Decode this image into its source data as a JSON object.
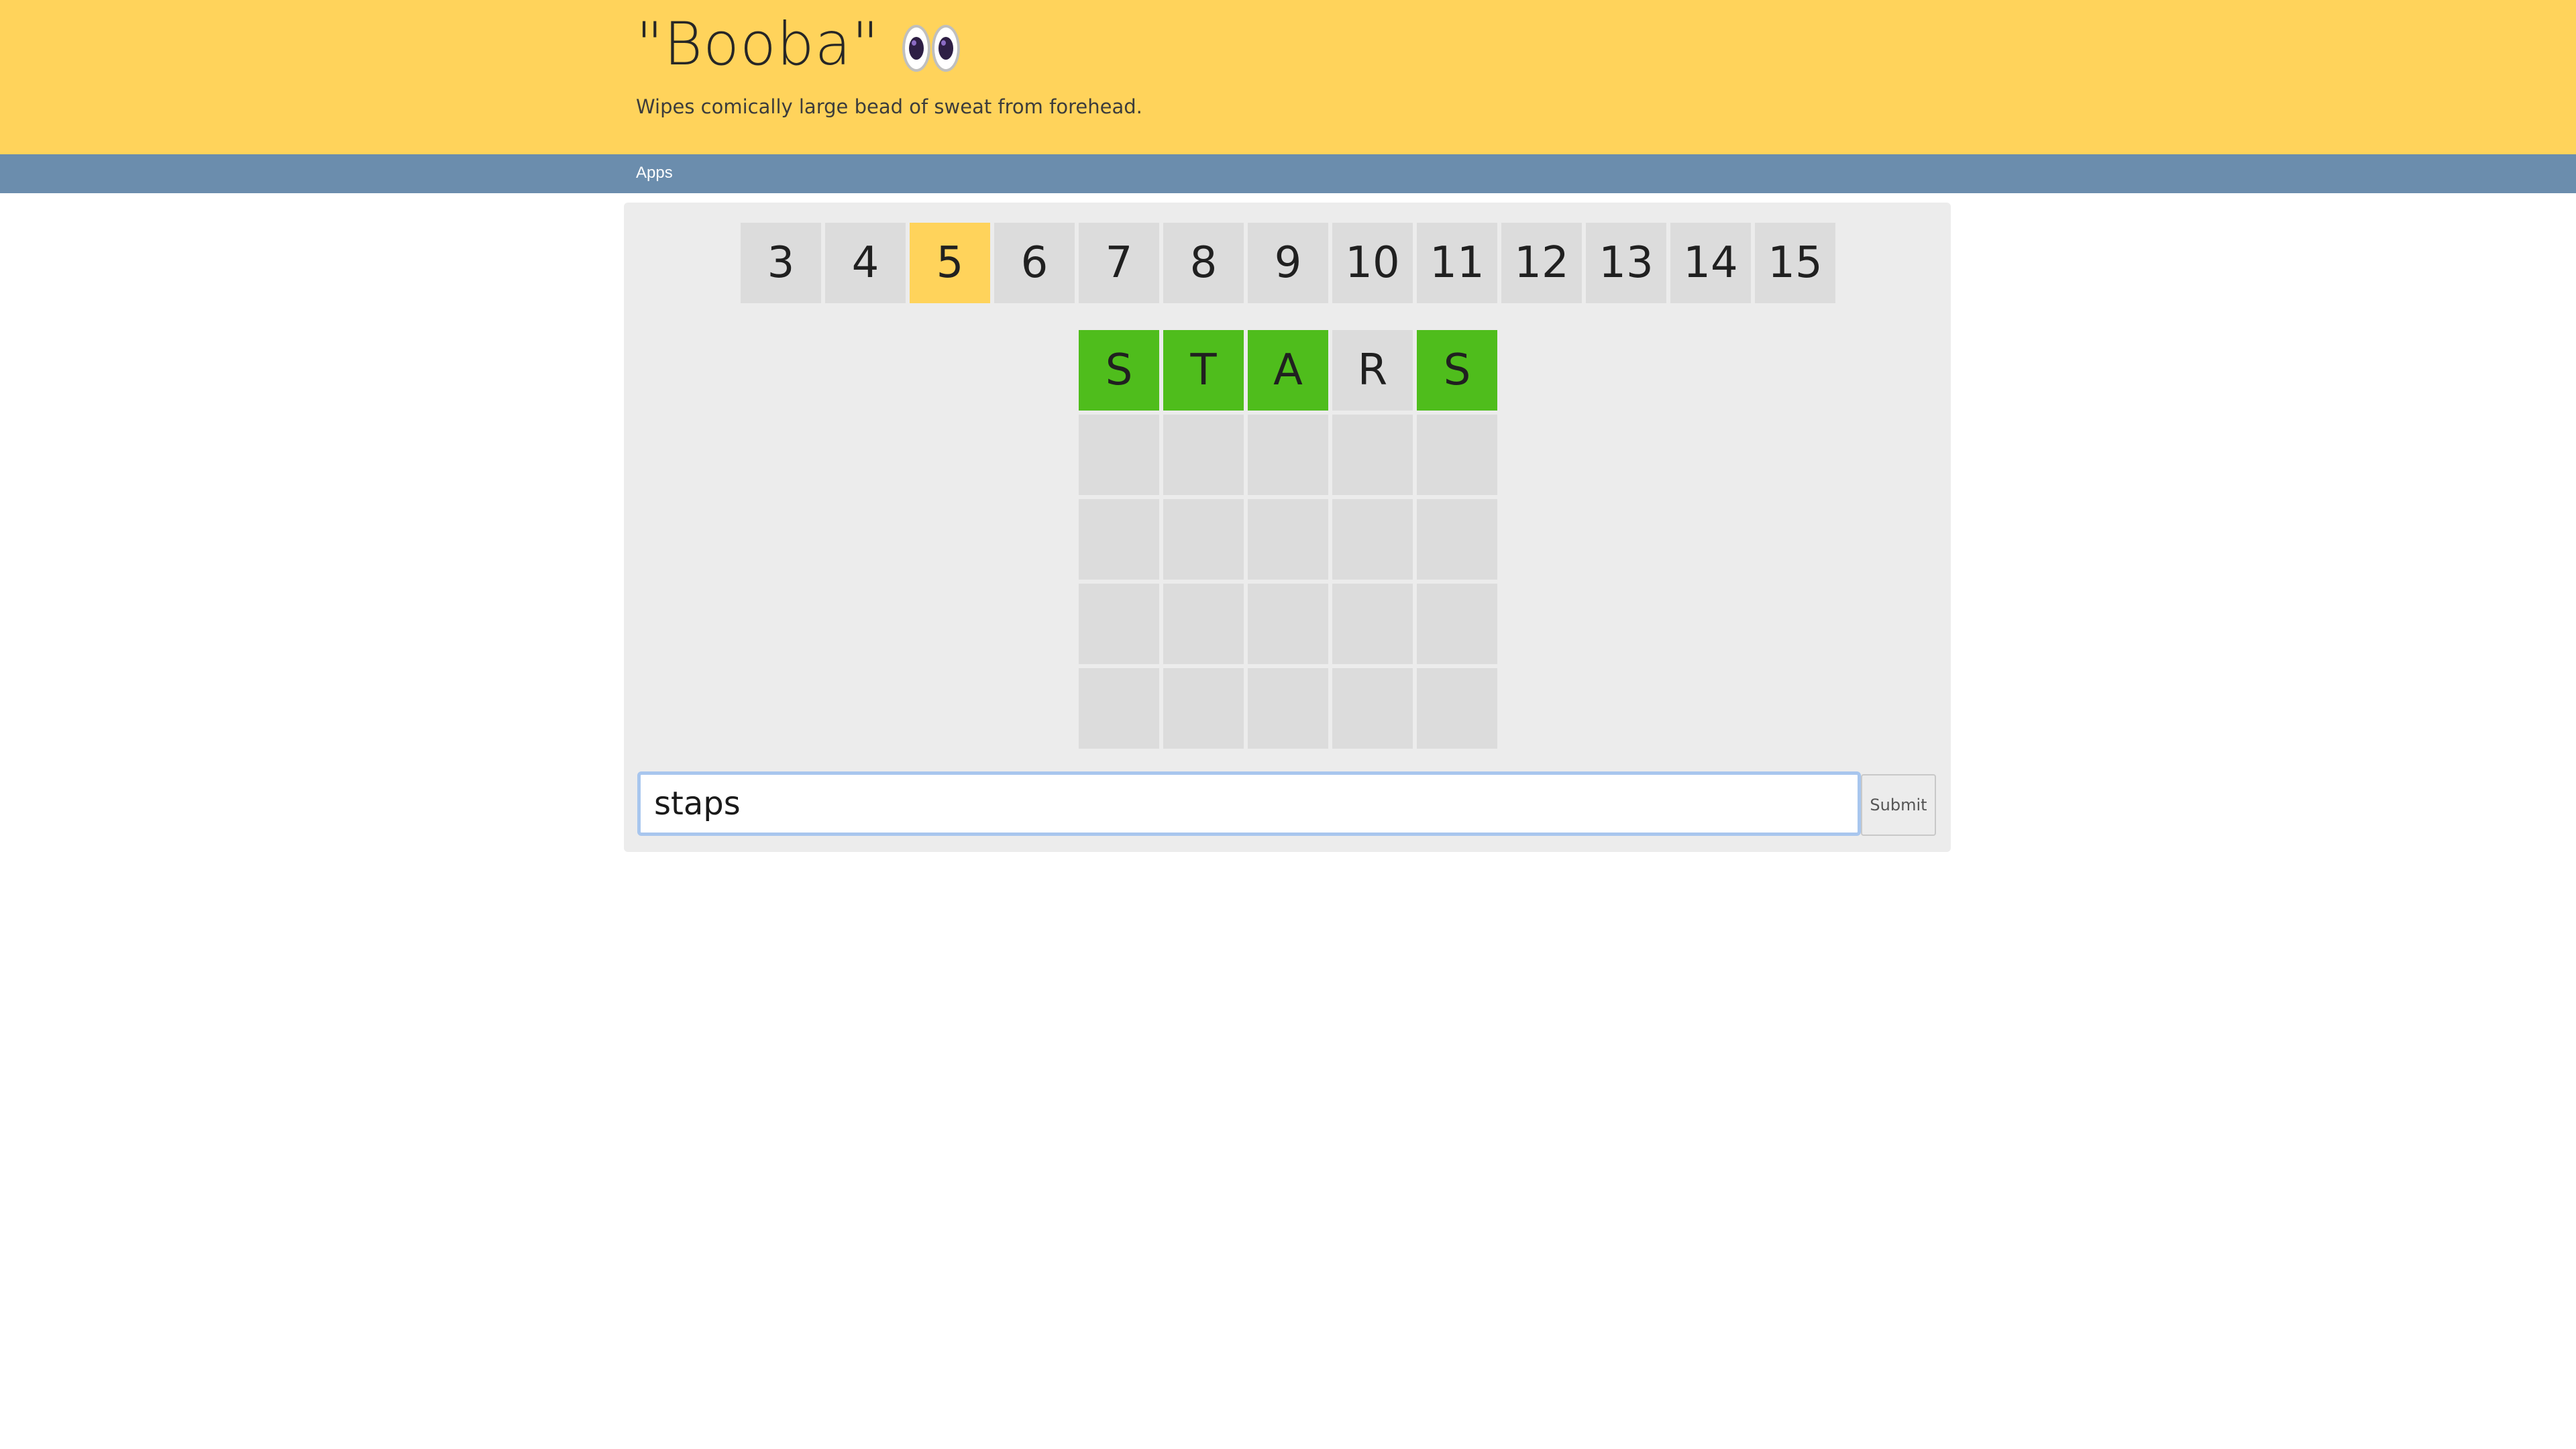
{
  "header": {
    "title": "\"Booba\"",
    "subtitle": "Wipes comically large bead of sweat from forehead.",
    "logo_icon": "eyes-emoji",
    "background": "#ffd35b"
  },
  "nav": {
    "apps_label": "Apps",
    "background": "#6b8dad"
  },
  "length_tabs": {
    "items": [
      "3",
      "4",
      "5",
      "6",
      "7",
      "8",
      "9",
      "10",
      "11",
      "12",
      "13",
      "14",
      "15"
    ],
    "selected": "5",
    "selected_color": "#ffd35b"
  },
  "board": {
    "rows": [
      [
        {
          "letter": "S",
          "state": "correct"
        },
        {
          "letter": "T",
          "state": "correct"
        },
        {
          "letter": "A",
          "state": "correct"
        },
        {
          "letter": "R",
          "state": "absent"
        },
        {
          "letter": "S",
          "state": "correct"
        }
      ],
      [
        {
          "letter": "",
          "state": "empty"
        },
        {
          "letter": "",
          "state": "empty"
        },
        {
          "letter": "",
          "state": "empty"
        },
        {
          "letter": "",
          "state": "empty"
        },
        {
          "letter": "",
          "state": "empty"
        }
      ],
      [
        {
          "letter": "",
          "state": "empty"
        },
        {
          "letter": "",
          "state": "empty"
        },
        {
          "letter": "",
          "state": "empty"
        },
        {
          "letter": "",
          "state": "empty"
        },
        {
          "letter": "",
          "state": "empty"
        }
      ],
      [
        {
          "letter": "",
          "state": "empty"
        },
        {
          "letter": "",
          "state": "empty"
        },
        {
          "letter": "",
          "state": "empty"
        },
        {
          "letter": "",
          "state": "empty"
        },
        {
          "letter": "",
          "state": "empty"
        }
      ],
      [
        {
          "letter": "",
          "state": "empty"
        },
        {
          "letter": "",
          "state": "empty"
        },
        {
          "letter": "",
          "state": "empty"
        },
        {
          "letter": "",
          "state": "empty"
        },
        {
          "letter": "",
          "state": "empty"
        }
      ]
    ],
    "correct_color": "#4fbd1c"
  },
  "guess": {
    "value": "staps",
    "submit_label": "Submit"
  }
}
